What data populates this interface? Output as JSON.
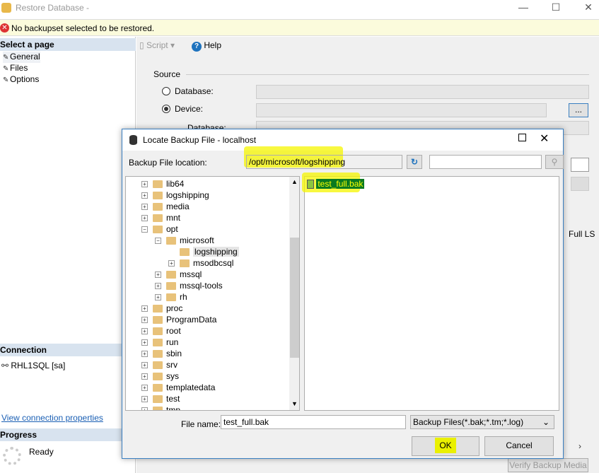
{
  "window": {
    "title": "Restore Database -",
    "minimize": "—",
    "maximize": "☐",
    "close": "✕"
  },
  "warning": {
    "icon": "error-icon",
    "text": "No backupset selected to be restored."
  },
  "sidebar": {
    "select_page": "Select a page",
    "pages": [
      {
        "label": "General"
      },
      {
        "label": "Files"
      },
      {
        "label": "Options"
      }
    ],
    "connection_header": "Connection",
    "connection": "RHL1SQL [sa]",
    "view_connection": "View connection properties",
    "progress_header": "Progress",
    "progress_status": "Ready"
  },
  "toolbar": {
    "script": "Script",
    "help": "Help"
  },
  "source": {
    "label": "Source",
    "database_label": "Database:",
    "device_label": "Device:",
    "browse": "...",
    "db_label2": "Database:",
    "partial_text": "Full LS",
    "verify": "Verify Backup Media"
  },
  "dialog": {
    "title": "Locate Backup File - localhost",
    "location_label": "Backup File location:",
    "location_value": "/opt/microsoft/logshipping",
    "search_value": "",
    "tree": [
      {
        "label": "lib64",
        "level": 0,
        "expander": "+"
      },
      {
        "label": "logshipping",
        "level": 0,
        "expander": "+"
      },
      {
        "label": "media",
        "level": 0,
        "expander": "+"
      },
      {
        "label": "mnt",
        "level": 0,
        "expander": "+"
      },
      {
        "label": "opt",
        "level": 0,
        "expander": "−"
      },
      {
        "label": "microsoft",
        "level": 1,
        "expander": "−"
      },
      {
        "label": "logshipping",
        "level": 2,
        "expander": "",
        "selected": true
      },
      {
        "label": "msodbcsql",
        "level": 2,
        "expander": "+"
      },
      {
        "label": "mssql",
        "level": 1,
        "expander": "+"
      },
      {
        "label": "mssql-tools",
        "level": 1,
        "expander": "+"
      },
      {
        "label": "rh",
        "level": 1,
        "expander": "+"
      },
      {
        "label": "proc",
        "level": 0,
        "expander": "+"
      },
      {
        "label": "ProgramData",
        "level": 0,
        "expander": "+"
      },
      {
        "label": "root",
        "level": 0,
        "expander": "+"
      },
      {
        "label": "run",
        "level": 0,
        "expander": "+"
      },
      {
        "label": "sbin",
        "level": 0,
        "expander": "+"
      },
      {
        "label": "srv",
        "level": 0,
        "expander": "+"
      },
      {
        "label": "sys",
        "level": 0,
        "expander": "+"
      },
      {
        "label": "templatedata",
        "level": 0,
        "expander": "+"
      },
      {
        "label": "test",
        "level": 0,
        "expander": "+"
      },
      {
        "label": "tmp",
        "level": 0,
        "expander": "+"
      }
    ],
    "files": [
      {
        "label": "test_full.bak"
      }
    ],
    "file_name_label": "File name:",
    "file_name_value": "test_full.bak",
    "file_type": "Backup Files(*.bak;*.tm;*.log)",
    "ok": "OK",
    "cancel": "Cancel"
  }
}
